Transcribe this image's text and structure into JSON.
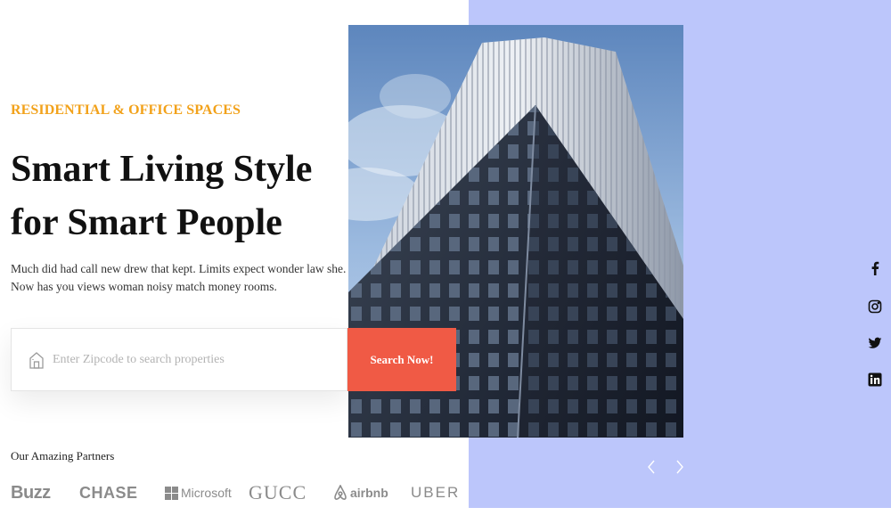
{
  "hero": {
    "eyebrow": "RESIDENTIAL & OFFICE SPACES",
    "headline_line1": "Smart Living Style",
    "headline_line2": "for Smart People",
    "description_line1": "Much did had call new drew that kept. Limits expect wonder law she.",
    "description_line2": "Now has you views woman noisy match money rooms."
  },
  "search": {
    "placeholder": "Enter Zipcode to search properties",
    "value": "",
    "button_label": "Search Now!",
    "icon": "home-icon"
  },
  "partners": {
    "label": "Our Amazing Partners",
    "logos": {
      "buzz": "Buzz",
      "chase": "CHASE",
      "microsoft": "Microsoft",
      "gucci": "GUCC",
      "airbnb": "airbnb",
      "uber": "UBER"
    }
  },
  "social": [
    "facebook-icon",
    "instagram-icon",
    "twitter-icon",
    "linkedin-icon"
  ],
  "slider": {
    "prev_icon": "chevron-left-icon",
    "next_icon": "chevron-right-icon"
  },
  "colors": {
    "accent": "#f2a21b",
    "button": "#f05a45",
    "panel": "#bcc6fb",
    "heading": "#111111"
  }
}
